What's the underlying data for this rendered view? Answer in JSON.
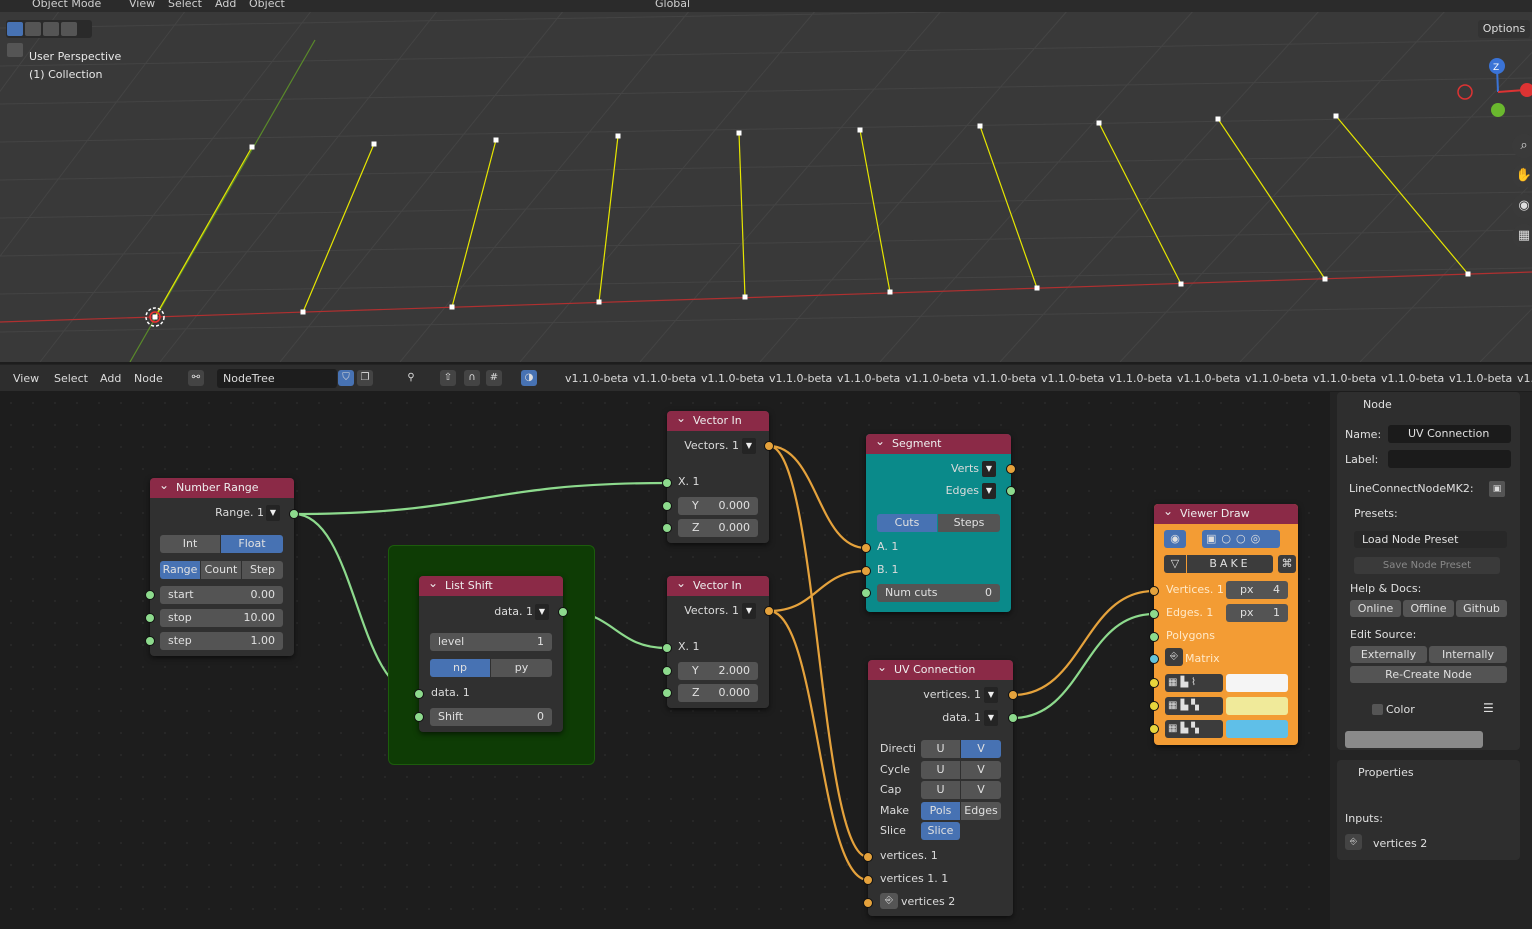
{
  "viewport": {
    "mode_label": "Object Mode",
    "menus": [
      "View",
      "Select",
      "Add",
      "Object"
    ],
    "transform_orientation": "Global",
    "options_label": "Options",
    "perspective_label": "User Perspective",
    "collection_label": "(1) Collection",
    "gizmo_z": "Z"
  },
  "node_editor": {
    "menus": [
      "View",
      "Select",
      "Add",
      "Node"
    ],
    "tree_name": "NodeTree",
    "version_labels": [
      "v1.1.0-beta",
      "v1.1.0-beta",
      "v1.1.0-beta",
      "v1.1.0-beta",
      "v1.1.0-beta",
      "v1.1.0-beta",
      "v1.1.0-beta",
      "v1.1.0-beta",
      "v1.1.0-beta",
      "v1.1.0-beta",
      "v1.1.0-beta",
      "v1.1.0-beta",
      "v1.1.0-beta",
      "v1.1.0-beta",
      "v1."
    ]
  },
  "nodes": {
    "number_range": {
      "title": "Number Range",
      "output": "Range. 1",
      "type_int": "Int",
      "type_float": "Float",
      "mode_range": "Range",
      "mode_count": "Count",
      "mode_step": "Step",
      "start_label": "start",
      "start_val": "0.00",
      "stop_label": "stop",
      "stop_val": "10.00",
      "step_label": "step",
      "step_val": "1.00"
    },
    "list_shift": {
      "title": "List Shift",
      "output": "data. 1",
      "level_label": "level",
      "level_val": "1",
      "np": "np",
      "py": "py",
      "input": "data. 1",
      "shift_label": "Shift",
      "shift_val": "0"
    },
    "vector_in_1": {
      "title": "Vector In",
      "output": "Vectors. 1",
      "x_label": "X. 1",
      "y_label": "Y",
      "y_val": "0.000",
      "z_label": "Z",
      "z_val": "0.000"
    },
    "vector_in_2": {
      "title": "Vector In",
      "output": "Vectors. 1",
      "x_label": "X. 1",
      "y_label": "Y",
      "y_val": "2.000",
      "z_label": "Z",
      "z_val": "0.000"
    },
    "segment": {
      "title": "Segment",
      "out_verts": "Verts",
      "out_edges": "Edges",
      "cuts": "Cuts",
      "steps": "Steps",
      "a": "A. 1",
      "b": "B. 1",
      "numcuts_label": "Num cuts",
      "numcuts_val": "0"
    },
    "uv_connection": {
      "title": "UV Connection",
      "out_vertices": "vertices. 1",
      "out_data": "data. 1",
      "direction_label": "Directi",
      "cycle_label": "Cycle",
      "cap_label": "Cap",
      "make_label": "Make",
      "slice_label": "Slice",
      "u": "U",
      "v": "V",
      "pols": "Pols",
      "edges": "Edges",
      "slice_btn": "Slice",
      "in1": "vertices. 1",
      "in2": "vertices 1. 1",
      "in3": "vertices 2"
    },
    "viewer_draw": {
      "title": "Viewer Draw",
      "bake": "BAKE",
      "vertices": "Vertices. 1",
      "edges": "Edges. 1",
      "polygons": "Polygons",
      "matrix": "Matrix",
      "px": "px",
      "vert_size": "4",
      "edge_size": "1",
      "color_vert": "#f5f5f5",
      "color_edge": "#f0ea9a",
      "color_poly": "#5fbfe8"
    }
  },
  "sidebar": {
    "node_panel": "Node",
    "name_label": "Name:",
    "name_value": "UV Connection",
    "label_label": "Label:",
    "node_id": "LineConnectNodeMK2:",
    "presets_label": "Presets:",
    "load_preset": "Load Node Preset",
    "save_preset": "Save Node Preset",
    "help_label": "Help & Docs:",
    "online": "Online",
    "offline": "Offline",
    "github": "Github",
    "edit_source": "Edit Source:",
    "externally": "Externally",
    "internally": "Internally",
    "recreate": "Re-Create Node",
    "color_label": "Color",
    "properties_panel": "Properties",
    "inputs_label": "Inputs:",
    "input_item": "vertices 2"
  },
  "colors": {
    "node_header": "#8b2a47",
    "segment_body": "#0a8a8a",
    "viewer_body": "#f39c34",
    "frame": "#0e3c05",
    "wire_green": "#8dda8d",
    "wire_orange": "#e5a23c",
    "accent": "#4772b3"
  }
}
